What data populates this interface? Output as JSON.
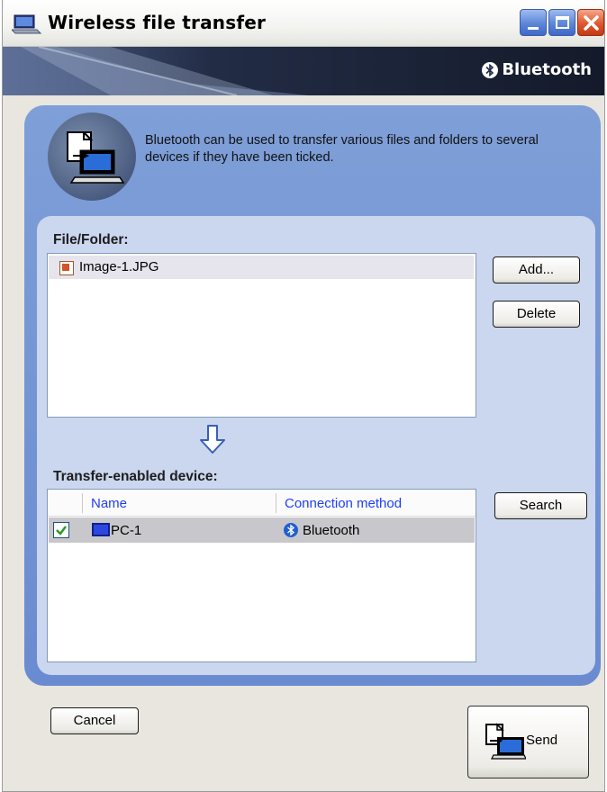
{
  "window": {
    "title": "Wireless file transfer",
    "title_icon": "laptop-icon",
    "controls": [
      "minimize-icon",
      "maximize-icon",
      "close-icon"
    ]
  },
  "banner": {
    "brand": "Bluetooth",
    "brand_icon": "bluetooth-icon"
  },
  "description": {
    "text": "Bluetooth can be used to transfer various files and folders to several devices if they have been ticked.",
    "icon": "file-transfer-icon"
  },
  "files": {
    "label": "File/Folder:",
    "items": [
      {
        "name": "Image-1.JPG",
        "icon": "image-file-icon"
      }
    ],
    "add_label": "Add...",
    "delete_label": "Delete"
  },
  "devices": {
    "label": "Transfer-enabled device:",
    "columns": [
      "Name",
      "Connection method"
    ],
    "items": [
      {
        "checked": true,
        "name": "PC-1",
        "icon": "pc-icon",
        "connection": "Bluetooth",
        "connection_icon": "bluetooth-icon"
      }
    ],
    "search_label": "Search"
  },
  "footer": {
    "cancel_label": "Cancel",
    "send_label": "Send",
    "send_icon": "send-file-icon"
  },
  "colors": {
    "panel_outer": "#6a8bd0",
    "panel_inner": "#cbd6ef",
    "column_header_text": "#1f3ef5",
    "selected_row": "#c8c8cc",
    "check_mark": "#2a9a2a"
  }
}
